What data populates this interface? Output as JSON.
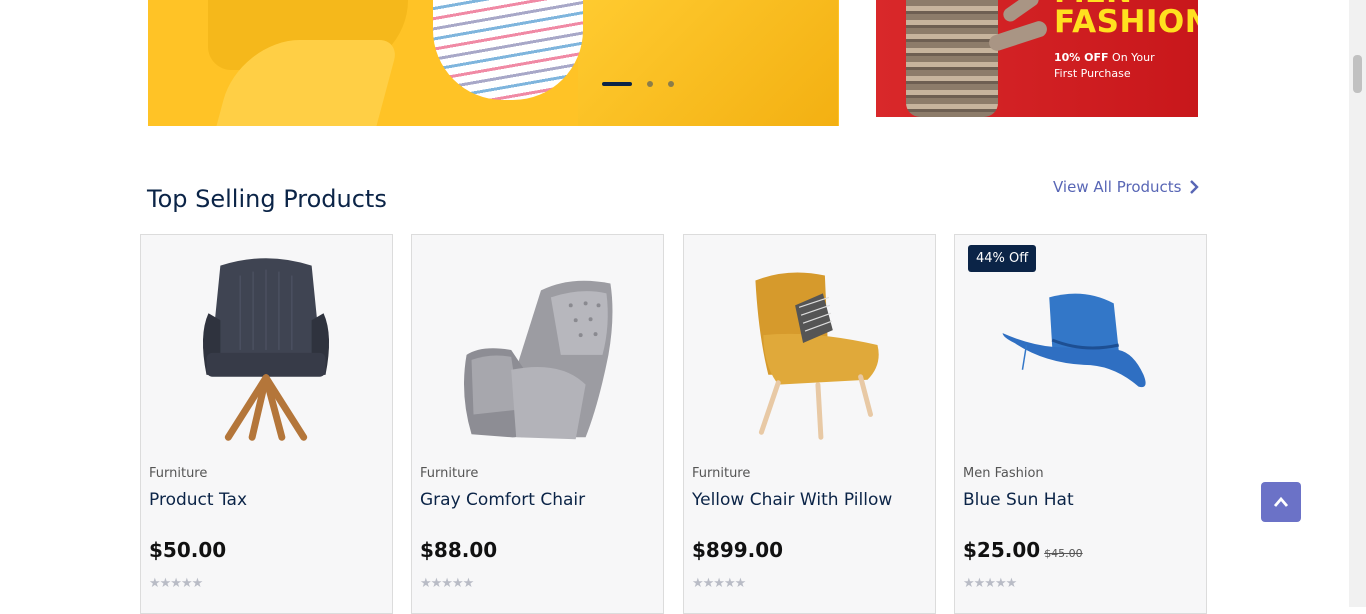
{
  "hero": {
    "left_banner": {
      "slider_dots": 3,
      "active_dot": 1
    },
    "right_banner": {
      "headline_top": "MEN",
      "headline": "FASHION",
      "offer_bold": "10% OFF",
      "offer_rest": "On Your",
      "offer_line2": "First Purchase"
    }
  },
  "section": {
    "title": "Top Selling Products",
    "view_all_label": "View All Products"
  },
  "products": [
    {
      "category": "Furniture",
      "name": "Product Tax",
      "price": "$50.00",
      "old_price": "",
      "badge": "",
      "rating": "★★★★★"
    },
    {
      "category": "Furniture",
      "name": "Gray Comfort Chair",
      "price": "$88.00",
      "old_price": "",
      "badge": "",
      "rating": "★★★★★"
    },
    {
      "category": "Furniture",
      "name": "Yellow Chair With Pillow",
      "price": "$899.00",
      "old_price": "",
      "badge": "",
      "rating": "★★★★★"
    },
    {
      "category": "Men Fashion",
      "name": "Blue Sun Hat",
      "price": "$25.00",
      "old_price": "$45.00",
      "badge": "44% Off",
      "rating": "★★★★★"
    }
  ],
  "colors": {
    "primary": "#0b2447",
    "accent": "#5866b5",
    "hero_yellow": "#ffc326",
    "hero_red": "#d9282a",
    "back_to_top": "#6b72c7"
  },
  "icons": {
    "view_all": "chevron-right-icon",
    "back_to_top": "chevron-up-icon"
  }
}
